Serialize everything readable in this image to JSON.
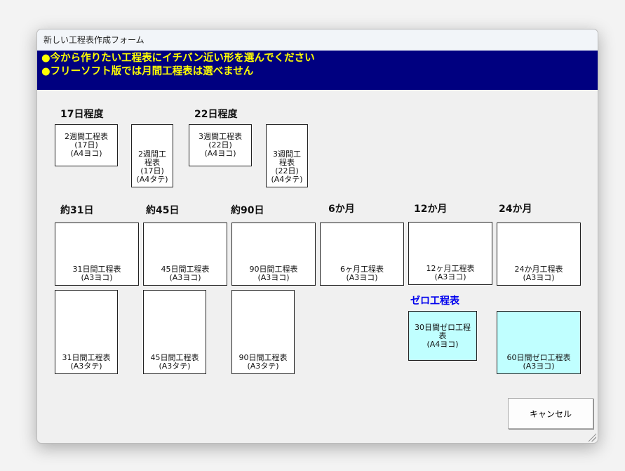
{
  "window": {
    "title": "新しい工程表作成フォーム"
  },
  "banner": {
    "line1": "●今から作りたい工程表にイチバン近い形を選んでください",
    "line2": "●フリーソフト版では月間工程表は選べません"
  },
  "sections": {
    "s17": "17日程度",
    "s22": "22日程度",
    "s31": "約31日",
    "s45": "約45日",
    "s90": "約90日",
    "m6": "6か月",
    "m12": "12か月",
    "m24": "24か月",
    "zero": "ゼロ工程表"
  },
  "buttons": {
    "w2y": "2週間工程表\n(17日)\n(A4ヨコ)",
    "w2t": "2週間工\n程表\n(17日)\n(A4タテ)",
    "w3y": "3週間工程表\n(22日)\n(A4ヨコ)",
    "w3t": "3週間工\n程表\n(22日)\n(A4タテ)",
    "d31y": "31日間工程表\n(A3ヨコ)",
    "d45y": "45日間工程表\n(A3ヨコ)",
    "d90y": "90日間工程表\n(A3ヨコ)",
    "m6y": "6ヶ月工程表\n(A3ヨコ)",
    "m12y": "12ヶ月工程表\n(A3ヨコ)",
    "m24y": "24か月工程表\n(A3ヨコ)",
    "d31t": "31日間工程表\n(A3タテ)",
    "d45t": "45日間工程表\n(A3タテ)",
    "d90t": "90日間工程表\n(A3タテ)",
    "z30": "30日間ゼロ工程\n表\n(A4ヨコ)",
    "z60": "60日間ゼロ工程表\n(A3ヨコ)"
  },
  "cancel": "キャンセル",
  "colors": {
    "banner_bg": "#000080",
    "banner_text": "#ffff00",
    "zero_bg": "#c0ffff",
    "zero_label": "#0000ee"
  }
}
